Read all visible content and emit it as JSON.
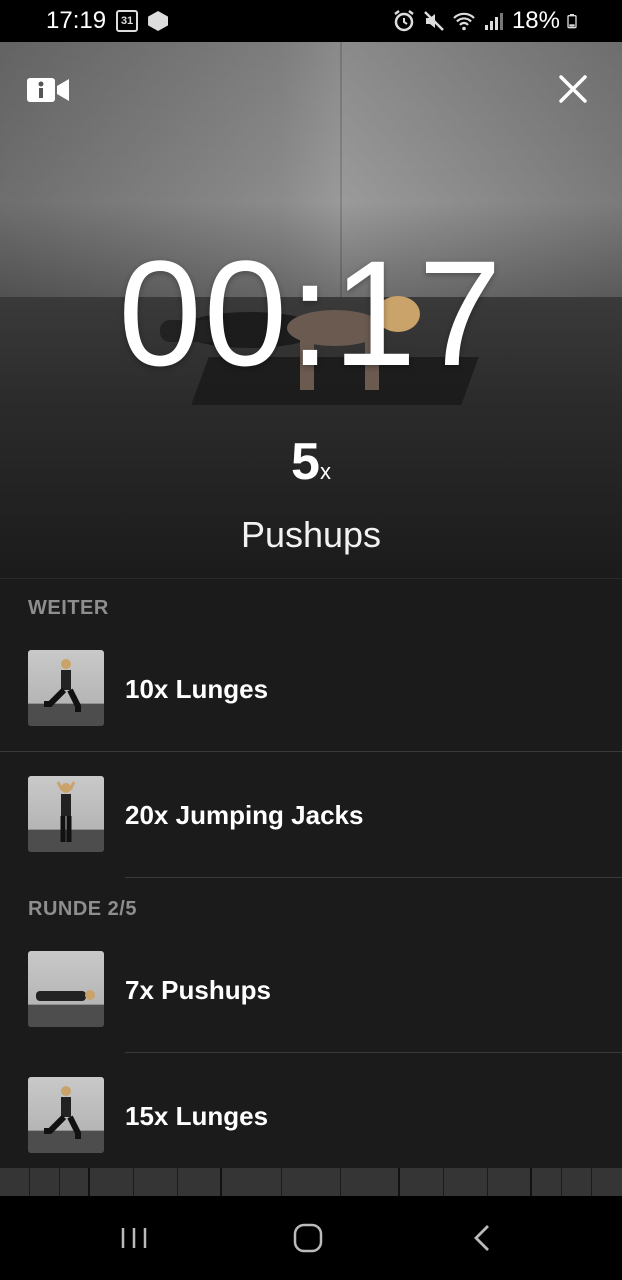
{
  "status_bar": {
    "time": "17:19",
    "calendar_day": "31",
    "battery": "18%"
  },
  "workout": {
    "timer": "00:17",
    "reps": "5",
    "reps_unit": "x",
    "exercise": "Pushups"
  },
  "sections": {
    "next_label": "WEITER",
    "round_label": "RUNDE 2/5"
  },
  "next_items": [
    {
      "label": "10x Lunges",
      "thumb": "lunges-thumbnail"
    },
    {
      "label": "20x Jumping Jacks",
      "thumb": "jumping-jacks-thumbnail"
    }
  ],
  "round_items": [
    {
      "label": "7x Pushups",
      "thumb": "pushups-thumbnail"
    },
    {
      "label": "15x Lunges",
      "thumb": "lunges-thumbnail"
    }
  ],
  "progress": {
    "completed_fraction": 0.0
  },
  "colors": {
    "background": "#1b1b1b",
    "section_label": "#8e8e8e",
    "divider": "#3a3a3a"
  }
}
